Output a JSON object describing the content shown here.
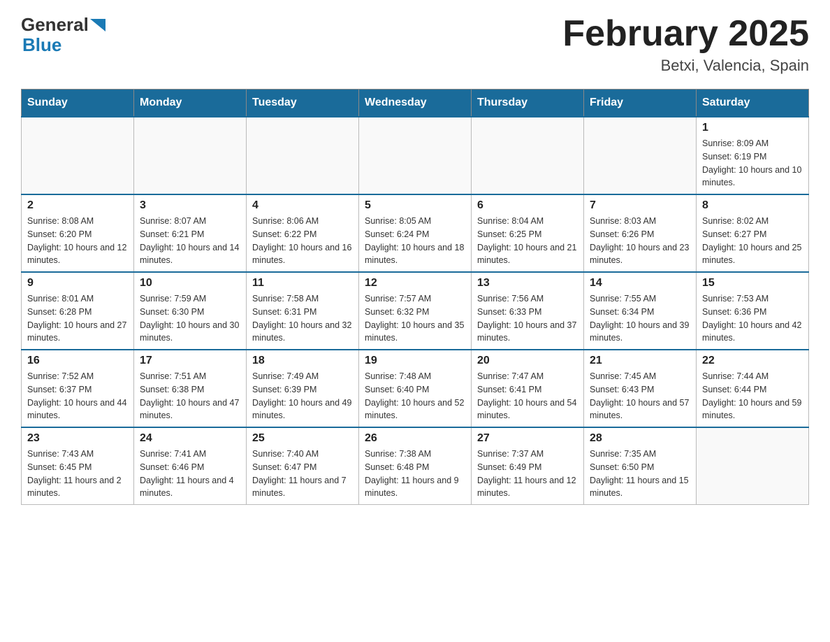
{
  "header": {
    "logo_general": "General",
    "logo_blue": "Blue",
    "title": "February 2025",
    "subtitle": "Betxi, Valencia, Spain"
  },
  "days_of_week": [
    "Sunday",
    "Monday",
    "Tuesday",
    "Wednesday",
    "Thursday",
    "Friday",
    "Saturday"
  ],
  "weeks": [
    [
      {
        "day": "",
        "info": ""
      },
      {
        "day": "",
        "info": ""
      },
      {
        "day": "",
        "info": ""
      },
      {
        "day": "",
        "info": ""
      },
      {
        "day": "",
        "info": ""
      },
      {
        "day": "",
        "info": ""
      },
      {
        "day": "1",
        "info": "Sunrise: 8:09 AM\nSunset: 6:19 PM\nDaylight: 10 hours and 10 minutes."
      }
    ],
    [
      {
        "day": "2",
        "info": "Sunrise: 8:08 AM\nSunset: 6:20 PM\nDaylight: 10 hours and 12 minutes."
      },
      {
        "day": "3",
        "info": "Sunrise: 8:07 AM\nSunset: 6:21 PM\nDaylight: 10 hours and 14 minutes."
      },
      {
        "day": "4",
        "info": "Sunrise: 8:06 AM\nSunset: 6:22 PM\nDaylight: 10 hours and 16 minutes."
      },
      {
        "day": "5",
        "info": "Sunrise: 8:05 AM\nSunset: 6:24 PM\nDaylight: 10 hours and 18 minutes."
      },
      {
        "day": "6",
        "info": "Sunrise: 8:04 AM\nSunset: 6:25 PM\nDaylight: 10 hours and 21 minutes."
      },
      {
        "day": "7",
        "info": "Sunrise: 8:03 AM\nSunset: 6:26 PM\nDaylight: 10 hours and 23 minutes."
      },
      {
        "day": "8",
        "info": "Sunrise: 8:02 AM\nSunset: 6:27 PM\nDaylight: 10 hours and 25 minutes."
      }
    ],
    [
      {
        "day": "9",
        "info": "Sunrise: 8:01 AM\nSunset: 6:28 PM\nDaylight: 10 hours and 27 minutes."
      },
      {
        "day": "10",
        "info": "Sunrise: 7:59 AM\nSunset: 6:30 PM\nDaylight: 10 hours and 30 minutes."
      },
      {
        "day": "11",
        "info": "Sunrise: 7:58 AM\nSunset: 6:31 PM\nDaylight: 10 hours and 32 minutes."
      },
      {
        "day": "12",
        "info": "Sunrise: 7:57 AM\nSunset: 6:32 PM\nDaylight: 10 hours and 35 minutes."
      },
      {
        "day": "13",
        "info": "Sunrise: 7:56 AM\nSunset: 6:33 PM\nDaylight: 10 hours and 37 minutes."
      },
      {
        "day": "14",
        "info": "Sunrise: 7:55 AM\nSunset: 6:34 PM\nDaylight: 10 hours and 39 minutes."
      },
      {
        "day": "15",
        "info": "Sunrise: 7:53 AM\nSunset: 6:36 PM\nDaylight: 10 hours and 42 minutes."
      }
    ],
    [
      {
        "day": "16",
        "info": "Sunrise: 7:52 AM\nSunset: 6:37 PM\nDaylight: 10 hours and 44 minutes."
      },
      {
        "day": "17",
        "info": "Sunrise: 7:51 AM\nSunset: 6:38 PM\nDaylight: 10 hours and 47 minutes."
      },
      {
        "day": "18",
        "info": "Sunrise: 7:49 AM\nSunset: 6:39 PM\nDaylight: 10 hours and 49 minutes."
      },
      {
        "day": "19",
        "info": "Sunrise: 7:48 AM\nSunset: 6:40 PM\nDaylight: 10 hours and 52 minutes."
      },
      {
        "day": "20",
        "info": "Sunrise: 7:47 AM\nSunset: 6:41 PM\nDaylight: 10 hours and 54 minutes."
      },
      {
        "day": "21",
        "info": "Sunrise: 7:45 AM\nSunset: 6:43 PM\nDaylight: 10 hours and 57 minutes."
      },
      {
        "day": "22",
        "info": "Sunrise: 7:44 AM\nSunset: 6:44 PM\nDaylight: 10 hours and 59 minutes."
      }
    ],
    [
      {
        "day": "23",
        "info": "Sunrise: 7:43 AM\nSunset: 6:45 PM\nDaylight: 11 hours and 2 minutes."
      },
      {
        "day": "24",
        "info": "Sunrise: 7:41 AM\nSunset: 6:46 PM\nDaylight: 11 hours and 4 minutes."
      },
      {
        "day": "25",
        "info": "Sunrise: 7:40 AM\nSunset: 6:47 PM\nDaylight: 11 hours and 7 minutes."
      },
      {
        "day": "26",
        "info": "Sunrise: 7:38 AM\nSunset: 6:48 PM\nDaylight: 11 hours and 9 minutes."
      },
      {
        "day": "27",
        "info": "Sunrise: 7:37 AM\nSunset: 6:49 PM\nDaylight: 11 hours and 12 minutes."
      },
      {
        "day": "28",
        "info": "Sunrise: 7:35 AM\nSunset: 6:50 PM\nDaylight: 11 hours and 15 minutes."
      },
      {
        "day": "",
        "info": ""
      }
    ]
  ]
}
